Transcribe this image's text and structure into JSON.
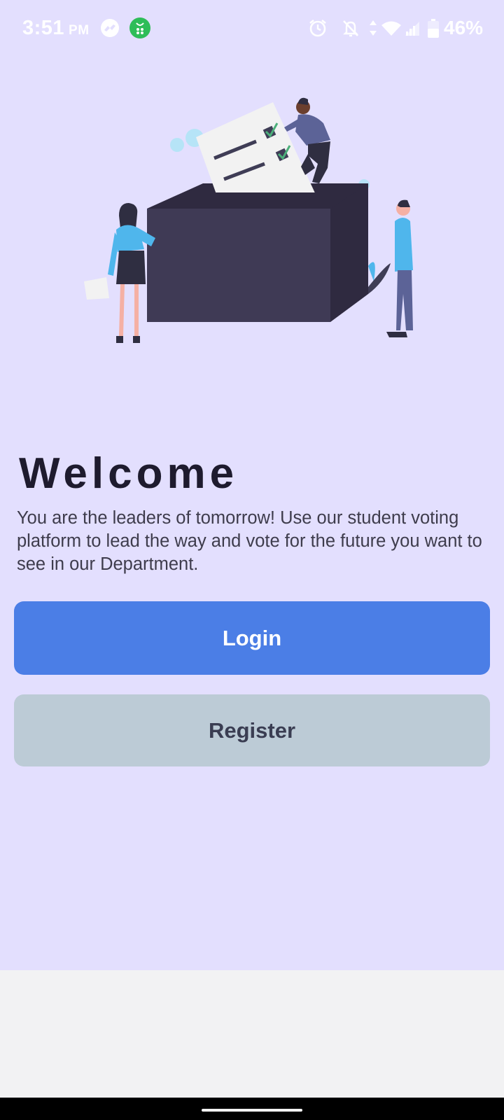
{
  "status_bar": {
    "time": "3:51",
    "ampm": "PM",
    "battery": "46%",
    "icons": [
      "messenger-icon",
      "app-notification-icon",
      "alarm-icon",
      "muted-bell-icon",
      "data-arrows-icon",
      "wifi-icon",
      "signal-icon",
      "battery-icon"
    ]
  },
  "welcome": {
    "title": "Welcome",
    "description": "You are the leaders of tomorrow! Use our student voting platform to lead the way and vote for the future you want to see in our Department."
  },
  "buttons": {
    "login": "Login",
    "register": "Register"
  },
  "colors": {
    "background": "#e3dffe",
    "login_button": "#4b7ee6",
    "register_button": "#bccbd6",
    "title_text": "#1e1b2e"
  }
}
